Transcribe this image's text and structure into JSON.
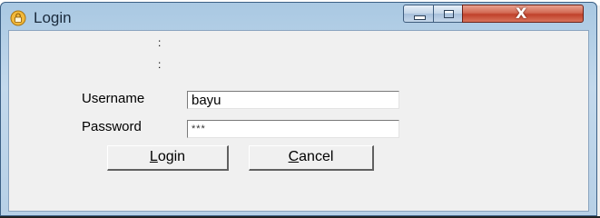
{
  "window": {
    "title": "Login",
    "icon": "lock-icon",
    "controls": {
      "minimize": "minimize-icon",
      "maximize": "maximize-icon",
      "close_glyph": "X"
    }
  },
  "form": {
    "colon_1": ":",
    "colon_2": ":",
    "username_label": "Username",
    "username_value": "bayu",
    "password_label": "Password",
    "password_value": "***",
    "login_button": "Login",
    "cancel_button": "Cancel"
  },
  "colors": {
    "client_background": "#f0f0f0",
    "close_button": "#c0412a",
    "title_bar": "#b7d0e6"
  }
}
